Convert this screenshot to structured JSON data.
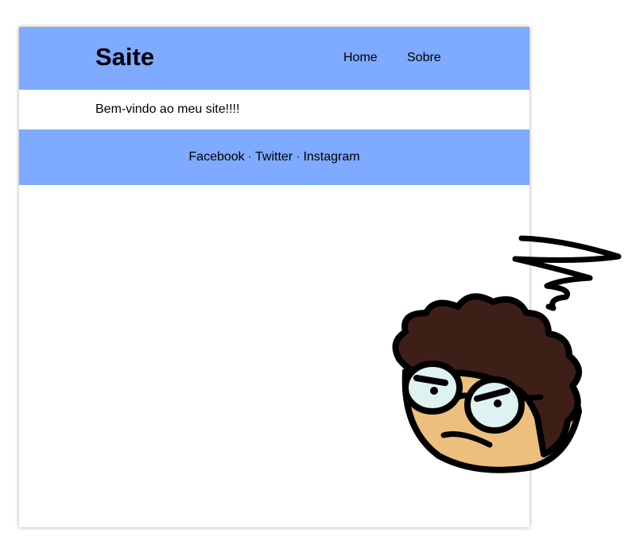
{
  "header": {
    "title": "Saite",
    "nav": [
      {
        "label": "Home"
      },
      {
        "label": "Sobre"
      }
    ]
  },
  "main": {
    "welcome": "Bem-vindo ao meu site!!!!"
  },
  "footer": {
    "links": [
      {
        "label": "Facebook"
      },
      {
        "label": "Twitter"
      },
      {
        "label": "Instagram"
      }
    ],
    "separator": "·"
  },
  "colors": {
    "header_bg": "#7eaaff",
    "footer_bg": "#7eaaff",
    "page_bg": "#ffffff"
  },
  "mascot": {
    "icon": "annoyed-character-icon"
  }
}
